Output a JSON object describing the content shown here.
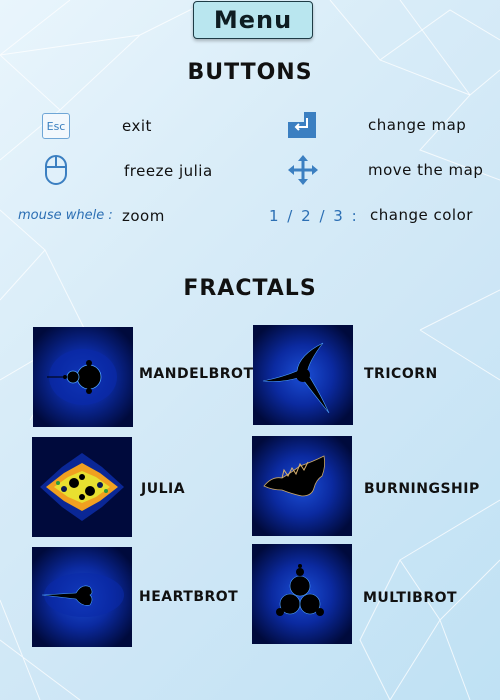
{
  "header": {
    "menu_label": "Menu"
  },
  "buttons_section": {
    "title": "Buttons",
    "items": [
      {
        "icon": "esc-key-icon",
        "esc_text": "Esc",
        "label": "exit"
      },
      {
        "icon": "return-key-icon",
        "label": "change map"
      },
      {
        "icon": "mouse-icon",
        "label": "freeze julia"
      },
      {
        "icon": "move-arrows-icon",
        "label": "move the map"
      },
      {
        "hint": "mouse whele :",
        "label": "zoom"
      },
      {
        "hint": "1 / 2 / 3 :",
        "label": "change color"
      }
    ]
  },
  "fractals_section": {
    "title": "Fractals",
    "items": [
      {
        "name": "Mandelbrot"
      },
      {
        "name": "Tricorn"
      },
      {
        "name": "Julia"
      },
      {
        "name": "Burningship"
      },
      {
        "name": "Heartbrot"
      },
      {
        "name": "Multibrot"
      }
    ]
  },
  "colors": {
    "accent_blue": "#2c6fb4",
    "menu_button_bg": "#b9e6ef",
    "fractal_dark_bg": "#000a3c"
  }
}
